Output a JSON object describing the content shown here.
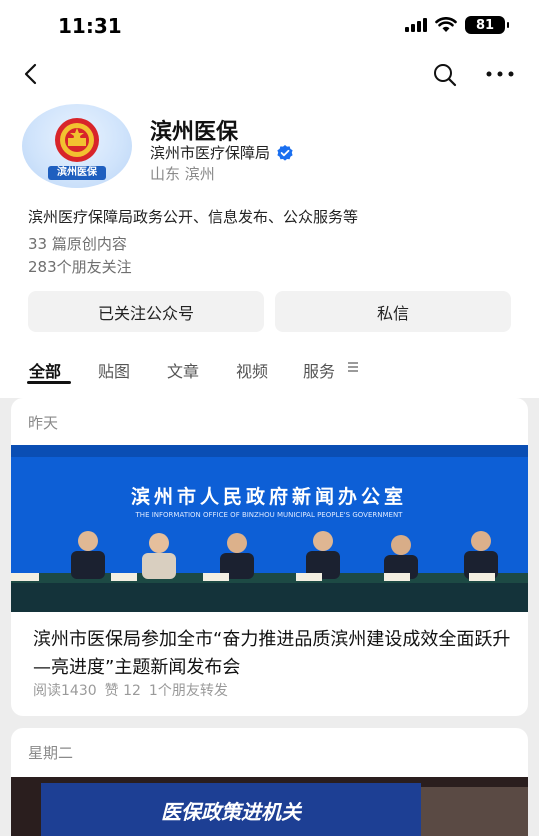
{
  "status_bar": {
    "time": "11:31",
    "battery": "81"
  },
  "nav": {
    "back_icon": "chevron-left-icon",
    "search_icon": "search-icon",
    "more_icon": "more-icon"
  },
  "profile": {
    "avatar_text": "滨州医保",
    "name": "滨州医保",
    "org": "滨州市医疗保障局",
    "location": "山东 滨州",
    "description": "滨州医疗保障局政务公开、信息发布、公众服务等",
    "original_count": "33 篇原创内容",
    "followers": "283个朋友关注"
  },
  "buttons": {
    "follow": "已关注公众号",
    "message": "私信"
  },
  "tabs": [
    "全部",
    "贴图",
    "文章",
    "视频",
    "服务"
  ],
  "feed": [
    {
      "day": "昨天",
      "image_banner_title": "滨州市人民政府新闻办公室",
      "image_banner_subtitle": "THE INFORMATION OFFICE OF BINZHOU MUNICIPAL PEOPLE'S GOVERNMENT",
      "title": "滨州市医保局参加全市“奋力推进品质滨州建设成效全面跃升—亮进度”主题新闻发布会",
      "reads": "阅读1430",
      "likes": "赞 12",
      "shares": "1个朋友转发"
    },
    {
      "day": "星期二",
      "image_banner_title": "医保政策进机关"
    }
  ],
  "colors": {
    "accent": "#1a6ff0",
    "background": "#ededed"
  }
}
